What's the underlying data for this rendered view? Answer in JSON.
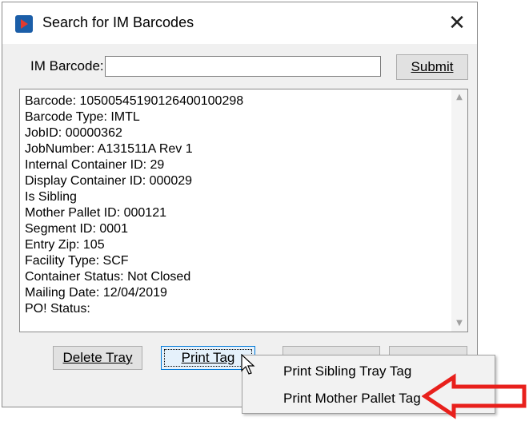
{
  "window": {
    "title": "Search for IM Barcodes",
    "close_glyph": "✕"
  },
  "search": {
    "label": "IM Barcode:",
    "value": "",
    "placeholder": "",
    "submit_label": "Submit"
  },
  "results": {
    "lines": [
      "Barcode: 10500545190126400100298",
      "Barcode Type: IMTL",
      "JobID: 00000362",
      "JobNumber: A131511A Rev 1",
      "Internal Container ID: 29",
      "Display Container ID: 000029",
      "Is Sibling",
      "Mother Pallet ID: 000121",
      "Segment ID: 0001",
      "Entry Zip: 105",
      "Facility Type: SCF",
      "Container Status: Not Closed",
      "Mailing Date: 12/04/2019",
      "PO! Status:"
    ]
  },
  "buttons": {
    "delete_label": "Delete Tray",
    "print_label": "Print Tag",
    "third_label": "",
    "fourth_label": ""
  },
  "context_menu": {
    "items": [
      "Print Sibling Tray Tag",
      "Print Mother Pallet Tag"
    ]
  },
  "annotation": {
    "arrow_color": "#e8201c",
    "icon": "red-outline-arrow-icon"
  },
  "icons": {
    "app": "app-logo-icon",
    "close": "close-icon",
    "scroll_up": "scroll-up-icon",
    "scroll_down": "scroll-down-icon",
    "cursor": "mouse-cursor-icon"
  },
  "colors": {
    "focus_border": "#0078d7",
    "dialog_bg": "#f0f0f0",
    "app_icon_blue": "#1b5ea8",
    "app_icon_red": "#e23a2e"
  }
}
